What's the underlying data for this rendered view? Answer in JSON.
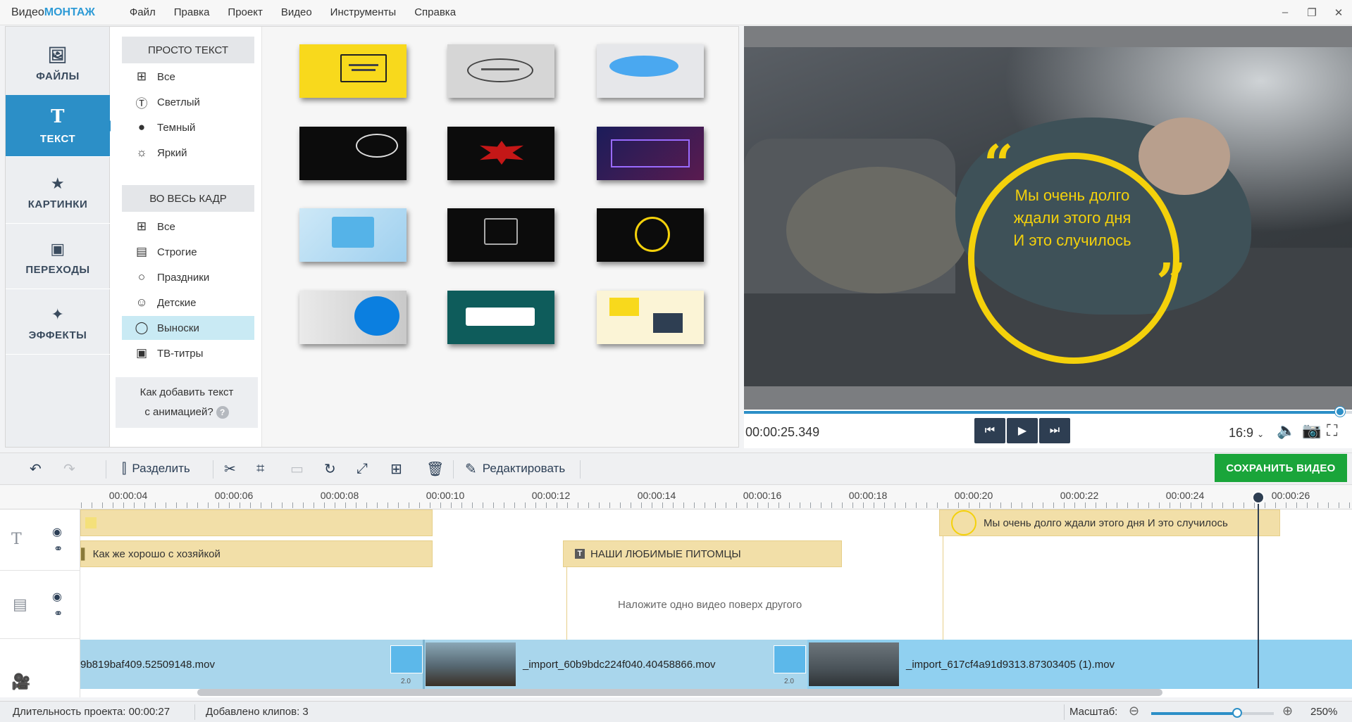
{
  "app": {
    "title_prefix": "Видео",
    "title_brand": "МОНТАЖ"
  },
  "menu": [
    "Файл",
    "Правка",
    "Проект",
    "Видео",
    "Инструменты",
    "Справка"
  ],
  "window_controls": {
    "minimize": "–",
    "restore": "❐",
    "close": "✕"
  },
  "categories": [
    {
      "label": "ФАЙЛЫ",
      "icon": "image-icon",
      "glyph": "🖼",
      "active": false
    },
    {
      "label": "ТЕКСТ",
      "icon": "text-icon",
      "glyph": "T",
      "active": true
    },
    {
      "label": "КАРТИНКИ",
      "icon": "star-icon",
      "glyph": "★",
      "active": false
    },
    {
      "label": "ПЕРЕХОДЫ",
      "icon": "transitions-icon",
      "glyph": "▣",
      "active": false
    },
    {
      "label": "ЭФФЕКТЫ",
      "icon": "magic-wand-icon",
      "glyph": "✨",
      "active": false
    }
  ],
  "subgroups": {
    "simple": {
      "heading": "ПРОСТО ТЕКСТ",
      "items": [
        {
          "label": "Все",
          "icon": "grid-icon",
          "glyph": "⊞"
        },
        {
          "label": "Светлый",
          "icon": "text-circle-outline-icon",
          "glyph": "Ⓣ"
        },
        {
          "label": "Темный",
          "icon": "text-circle-filled-icon",
          "glyph": "●"
        },
        {
          "label": "Яркий",
          "icon": "sun-icon",
          "glyph": "☼"
        }
      ]
    },
    "fullframe": {
      "heading": "ВО ВЕСЬ КАДР",
      "items": [
        {
          "label": "Все",
          "icon": "grid-icon",
          "glyph": "⊞",
          "active": false
        },
        {
          "label": "Строгие",
          "icon": "clapperboard-icon",
          "glyph": "🎬",
          "active": false
        },
        {
          "label": "Праздники",
          "icon": "balloon-icon",
          "glyph": "🎈",
          "active": false
        },
        {
          "label": "Детские",
          "icon": "baby-icon",
          "glyph": "☺",
          "active": false
        },
        {
          "label": "Выноски",
          "icon": "speech-bubble-icon",
          "glyph": "💬",
          "active": true
        },
        {
          "label": "ТВ-титры",
          "icon": "tv-icon",
          "glyph": "📺",
          "active": false
        }
      ]
    }
  },
  "help": {
    "line1": "Как добавить текст",
    "line2": "с анимацией?",
    "badge": "?"
  },
  "preview": {
    "caption_lines": [
      "Мы очень долго",
      "ждали этого дня",
      "И это случилось"
    ],
    "timecode": "00:00:25.349",
    "progress_fraction": 0.98,
    "aspect_ratio": "16:9",
    "accent_color": "#2c8fc7",
    "caption_color": "#f4d10b"
  },
  "toolbar": {
    "split": "Разделить",
    "edit": "Редактировать",
    "save": "СОХРАНИТЬ ВИДЕО"
  },
  "ruler": [
    "00:00:04",
    "00:00:06",
    "00:00:08",
    "00:00:10",
    "00:00:12",
    "00:00:14",
    "00:00:16",
    "00:00:18",
    "00:00:20",
    "00:00:22",
    "00:00:24",
    "00:00:26"
  ],
  "timeline": {
    "text_clip_1": "Как же хорошо  с хозяйкой",
    "text_clip_2": "НАШИ ЛЮБИМЫЕ  ПИТОМЦЫ",
    "text_clip_3": "Мы очень долго   ждали этого дня   И это случилось",
    "overlay_hint": "Наложите одно видео поверх другого",
    "video_clip_1": "9b819baf409.52509148.mov",
    "video_clip_2": "_import_60b9bdc224f040.40458866.mov",
    "video_clip_3": "_import_617cf4a91d9313.87303405 (1).mov",
    "transition_label": "2.0"
  },
  "status": {
    "duration_label": "Длительность проекта:",
    "duration_value": "00:00:27",
    "clips_label": "Добавлено клипов:",
    "clips_value": "3",
    "zoom_label": "Масштаб:",
    "zoom_value": "250%",
    "zoom_fraction": 0.7
  }
}
